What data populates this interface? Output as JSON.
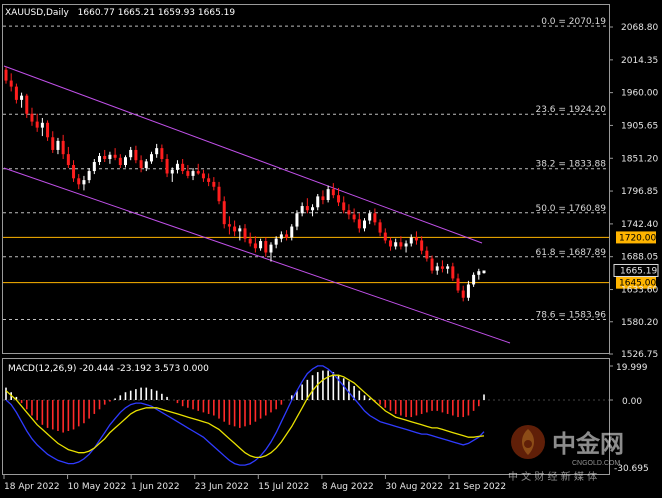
{
  "symbol_header": {
    "symbol": "XAUUSD,Daily",
    "ohlc": "1660.77 1665.21 1659.93 1665.19"
  },
  "colors": {
    "background": "#000000",
    "bull_candle": "#ffffff",
    "bear_candle": "#ff1e1e",
    "channel": "#c050e8",
    "hline": "#ffb400",
    "grid": "#ffffff",
    "macd_hist_pos": "#ffffff",
    "macd_hist_neg": "#ff2a2a",
    "macd_line": "#2f3bff",
    "signal_line": "#e8e000",
    "axis": "#9a9a9a"
  },
  "price_axis": {
    "ticks": [
      "2068.80",
      "2014.35",
      "1960.00",
      "1905.65",
      "1851.20",
      "1796.85",
      "1742.40",
      "1688.05",
      "1633.60",
      "1580.20",
      "1526.75"
    ],
    "last_price": "1665.19"
  },
  "fib_levels": [
    {
      "label": "0.0 = 2070.19",
      "price": 2070.19
    },
    {
      "label": "23.6 = 1924.20",
      "price": 1924.2
    },
    {
      "label": "38.2 = 1833.88",
      "price": 1833.88
    },
    {
      "label": "50.0 = 1760.89",
      "price": 1760.89
    },
    {
      "label": "61.8 = 1687.89",
      "price": 1687.89
    },
    {
      "label": "78.6 = 1583.96",
      "price": 1583.96
    }
  ],
  "horizontal_levels": [
    {
      "label": "1720.00",
      "price": 1720.0
    },
    {
      "label": "1645.00",
      "price": 1645.0
    }
  ],
  "macd_panel": {
    "title": "MACD(12,26,9) -20.444 -23.192 3.573 0.000",
    "ticks": [
      "19.999",
      "0.00",
      "-30.695"
    ]
  },
  "time_axis": [
    "18 Apr 2022",
    "10 May 2022",
    "1 Jun 2022",
    "23 Jun 2022",
    "15 Jul 2022",
    "8 Aug 2022",
    "30 Aug 2022",
    "21 Sep 2022"
  ],
  "watermark": {
    "brand": "中金网",
    "domain": "CNGOLD.COM",
    "slogan": "中 文 财 经 新 媒 体"
  },
  "chart_data": {
    "type": "candlestick",
    "title": "XAUUSD,Daily",
    "price_range": [
      1526.75,
      2081.0
    ],
    "candles": [
      [
        1998,
        2002,
        1975,
        1980
      ],
      [
        1980,
        1992,
        1962,
        1970
      ],
      [
        1970,
        1975,
        1942,
        1948
      ],
      [
        1948,
        1960,
        1935,
        1955
      ],
      [
        1955,
        1958,
        1918,
        1925
      ],
      [
        1925,
        1935,
        1905,
        1912
      ],
      [
        1912,
        1925,
        1895,
        1902
      ],
      [
        1902,
        1918,
        1888,
        1910
      ],
      [
        1910,
        1914,
        1880,
        1886
      ],
      [
        1886,
        1896,
        1860,
        1865
      ],
      [
        1865,
        1885,
        1858,
        1880
      ],
      [
        1880,
        1890,
        1850,
        1858
      ],
      [
        1858,
        1870,
        1835,
        1840
      ],
      [
        1840,
        1848,
        1812,
        1818
      ],
      [
        1818,
        1825,
        1800,
        1808
      ],
      [
        1808,
        1822,
        1798,
        1815
      ],
      [
        1815,
        1835,
        1810,
        1830
      ],
      [
        1830,
        1850,
        1825,
        1845
      ],
      [
        1845,
        1860,
        1840,
        1855
      ],
      [
        1855,
        1865,
        1845,
        1850
      ],
      [
        1850,
        1862,
        1842,
        1857
      ],
      [
        1857,
        1868,
        1848,
        1852
      ],
      [
        1852,
        1858,
        1835,
        1840
      ],
      [
        1840,
        1856,
        1836,
        1853
      ],
      [
        1853,
        1870,
        1848,
        1865
      ],
      [
        1865,
        1872,
        1843,
        1848
      ],
      [
        1848,
        1856,
        1828,
        1835
      ],
      [
        1835,
        1850,
        1830,
        1846
      ],
      [
        1846,
        1862,
        1842,
        1858
      ],
      [
        1858,
        1875,
        1852,
        1868
      ],
      [
        1868,
        1874,
        1845,
        1850
      ],
      [
        1850,
        1858,
        1820,
        1826
      ],
      [
        1826,
        1836,
        1812,
        1832
      ],
      [
        1832,
        1848,
        1826,
        1842
      ],
      [
        1842,
        1850,
        1825,
        1830
      ],
      [
        1830,
        1840,
        1818,
        1822
      ],
      [
        1822,
        1835,
        1815,
        1830
      ],
      [
        1830,
        1842,
        1824,
        1826
      ],
      [
        1826,
        1832,
        1812,
        1818
      ],
      [
        1818,
        1826,
        1805,
        1812
      ],
      [
        1812,
        1820,
        1798,
        1804
      ],
      [
        1804,
        1812,
        1775,
        1780
      ],
      [
        1780,
        1788,
        1735,
        1742
      ],
      [
        1742,
        1755,
        1725,
        1738
      ],
      [
        1738,
        1748,
        1722,
        1730
      ],
      [
        1730,
        1740,
        1715,
        1735
      ],
      [
        1735,
        1742,
        1712,
        1718
      ],
      [
        1718,
        1728,
        1705,
        1710
      ],
      [
        1710,
        1722,
        1695,
        1702
      ],
      [
        1702,
        1718,
        1698,
        1714
      ],
      [
        1714,
        1720,
        1688,
        1695
      ],
      [
        1695,
        1712,
        1680,
        1708
      ],
      [
        1708,
        1722,
        1702,
        1718
      ],
      [
        1718,
        1730,
        1712,
        1725
      ],
      [
        1725,
        1732,
        1715,
        1720
      ],
      [
        1720,
        1742,
        1715,
        1738
      ],
      [
        1738,
        1765,
        1732,
        1760
      ],
      [
        1760,
        1778,
        1755,
        1772
      ],
      [
        1772,
        1785,
        1760,
        1765
      ],
      [
        1765,
        1775,
        1755,
        1770
      ],
      [
        1770,
        1792,
        1765,
        1788
      ],
      [
        1788,
        1798,
        1775,
        1782
      ],
      [
        1782,
        1806,
        1778,
        1800
      ],
      [
        1800,
        1810,
        1785,
        1790
      ],
      [
        1790,
        1802,
        1772,
        1778
      ],
      [
        1778,
        1788,
        1760,
        1765
      ],
      [
        1765,
        1775,
        1750,
        1758
      ],
      [
        1758,
        1768,
        1745,
        1750
      ],
      [
        1750,
        1760,
        1728,
        1735
      ],
      [
        1735,
        1752,
        1730,
        1748
      ],
      [
        1748,
        1765,
        1742,
        1760
      ],
      [
        1760,
        1768,
        1740,
        1745
      ],
      [
        1745,
        1750,
        1722,
        1728
      ],
      [
        1728,
        1735,
        1710,
        1715
      ],
      [
        1715,
        1720,
        1698,
        1705
      ],
      [
        1705,
        1718,
        1700,
        1712
      ],
      [
        1712,
        1722,
        1700,
        1705
      ],
      [
        1705,
        1715,
        1695,
        1710
      ],
      [
        1710,
        1725,
        1705,
        1720
      ],
      [
        1720,
        1730,
        1708,
        1715
      ],
      [
        1715,
        1722,
        1692,
        1698
      ],
      [
        1698,
        1705,
        1680,
        1685
      ],
      [
        1685,
        1690,
        1660,
        1665
      ],
      [
        1665,
        1678,
        1658,
        1672
      ],
      [
        1672,
        1682,
        1662,
        1668
      ],
      [
        1668,
        1676,
        1660,
        1672
      ],
      [
        1672,
        1678,
        1648,
        1652
      ],
      [
        1652,
        1660,
        1628,
        1632
      ],
      [
        1632,
        1640,
        1614,
        1620
      ],
      [
        1620,
        1648,
        1615,
        1642
      ],
      [
        1642,
        1662,
        1638,
        1658
      ],
      [
        1658,
        1668,
        1650,
        1664
      ],
      [
        1660.77,
        1665.21,
        1659.93,
        1665.19
      ]
    ],
    "macd_histogram": [
      8,
      5,
      2,
      -2,
      -6,
      -10,
      -13,
      -16,
      -18,
      -19,
      -20,
      -21,
      -20,
      -19,
      -17,
      -15,
      -12,
      -9,
      -6,
      -3,
      -1,
      1,
      3,
      5,
      6,
      7,
      8,
      8,
      7,
      6,
      4,
      2,
      0,
      -2,
      -4,
      -5,
      -6,
      -7,
      -8,
      -9,
      -10,
      -12,
      -14,
      -16,
      -17,
      -18,
      -17,
      -16,
      -14,
      -12,
      -10,
      -8,
      -6,
      -3,
      0,
      3,
      6,
      10,
      13,
      16,
      18,
      19,
      19,
      18,
      16,
      14,
      12,
      9,
      6,
      3,
      1,
      -1,
      -3,
      -5,
      -7,
      -9,
      -10,
      -11,
      -11,
      -10,
      -9,
      -8,
      -7,
      -7,
      -8,
      -9,
      -10,
      -11,
      -11,
      -10,
      -7,
      -4,
      3.573
    ],
    "macd_line": [
      0,
      -3,
      -8,
      -14,
      -20,
      -25,
      -29,
      -32,
      -35,
      -37,
      -39,
      -40,
      -41,
      -41,
      -40,
      -38,
      -35,
      -31,
      -26,
      -21,
      -16,
      -12,
      -8,
      -5,
      -3,
      -2,
      -2,
      -3,
      -4,
      -6,
      -8,
      -10,
      -12,
      -14,
      -16,
      -18,
      -20,
      -22,
      -24,
      -27,
      -30,
      -33,
      -36,
      -39,
      -41,
      -42,
      -42,
      -41,
      -39,
      -36,
      -32,
      -27,
      -21,
      -14,
      -7,
      0,
      6,
      12,
      17,
      20,
      22,
      22,
      20,
      17,
      13,
      9,
      5,
      1,
      -3,
      -7,
      -10,
      -12,
      -14,
      -15,
      -16,
      -17,
      -18,
      -19,
      -20,
      -21,
      -22,
      -22,
      -23,
      -24,
      -25,
      -26,
      -27,
      -28,
      -29,
      -28,
      -26,
      -24,
      -20.444
    ],
    "signal_line": [
      6,
      3,
      0,
      -4,
      -8,
      -12,
      -16,
      -19,
      -22,
      -25,
      -28,
      -30,
      -32,
      -33,
      -34,
      -34,
      -33,
      -31,
      -28,
      -25,
      -21,
      -18,
      -15,
      -12,
      -9,
      -7,
      -6,
      -5,
      -5,
      -5,
      -6,
      -7,
      -8,
      -9,
      -10,
      -11,
      -12,
      -13,
      -14,
      -15,
      -17,
      -19,
      -22,
      -25,
      -28,
      -31,
      -34,
      -36,
      -37,
      -37,
      -36,
      -34,
      -31,
      -27,
      -22,
      -17,
      -11,
      -5,
      1,
      6,
      10,
      13,
      15,
      16,
      16,
      15,
      13,
      11,
      8,
      5,
      2,
      -1,
      -4,
      -7,
      -9,
      -11,
      -12,
      -13,
      -14,
      -15,
      -16,
      -17,
      -18,
      -18,
      -19,
      -20,
      -21,
      -22,
      -23,
      -24,
      -24,
      -23.5,
      -23.192
    ]
  }
}
